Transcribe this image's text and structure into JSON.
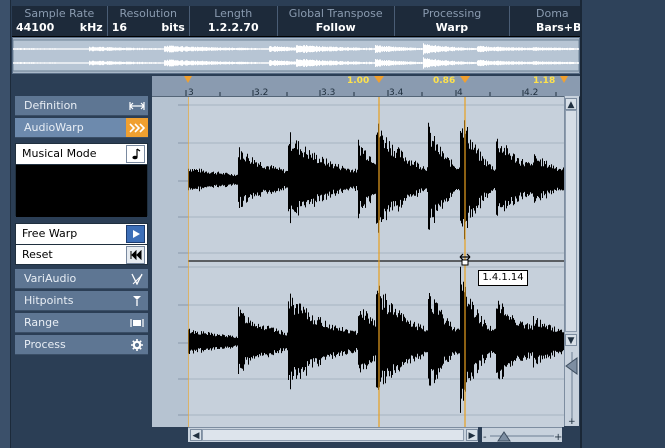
{
  "info_line": {
    "cells": [
      {
        "label": "Sample Rate",
        "value": "44100",
        "unit": "kHz"
      },
      {
        "label": "Resolution",
        "value": "16",
        "unit": "bits"
      },
      {
        "label": "Length",
        "value": "1.2.2.70"
      },
      {
        "label": "Global Transpose",
        "value": "Follow"
      },
      {
        "label": "Processing",
        "value": "Warp"
      },
      {
        "label": "Doma",
        "value": "Bars+B"
      }
    ]
  },
  "panel": {
    "definition": "Definition",
    "audiowarp": "AudioWarp",
    "musical_mode": "Musical Mode",
    "free_warp": "Free Warp",
    "reset": "Reset",
    "variaudio": "VariAudio",
    "hitpoints": "Hitpoints",
    "range": "Range",
    "process": "Process"
  },
  "ruler": {
    "ticks": [
      "3",
      "3.2",
      "3.3",
      "3.4",
      "4",
      "4.2"
    ],
    "warp_markers": [
      "1.00",
      "0.86",
      "1.18"
    ]
  },
  "tooltip": {
    "position": "1.4.1.14"
  },
  "colors": {
    "accent": "#f0a030",
    "warp_line": "#e8a020",
    "marker_text": "#ffe24a"
  },
  "icons": {
    "definition": "arrows-in-icon",
    "audiowarp": "triple-chevron-icon",
    "musical_mode": "note-icon",
    "free_warp": "play-arrow-icon",
    "reset": "rewind-icon",
    "variaudio": "variaudio-icon",
    "hitpoints": "hitpoint-icon",
    "range": "range-icon",
    "process": "gear-icon"
  }
}
